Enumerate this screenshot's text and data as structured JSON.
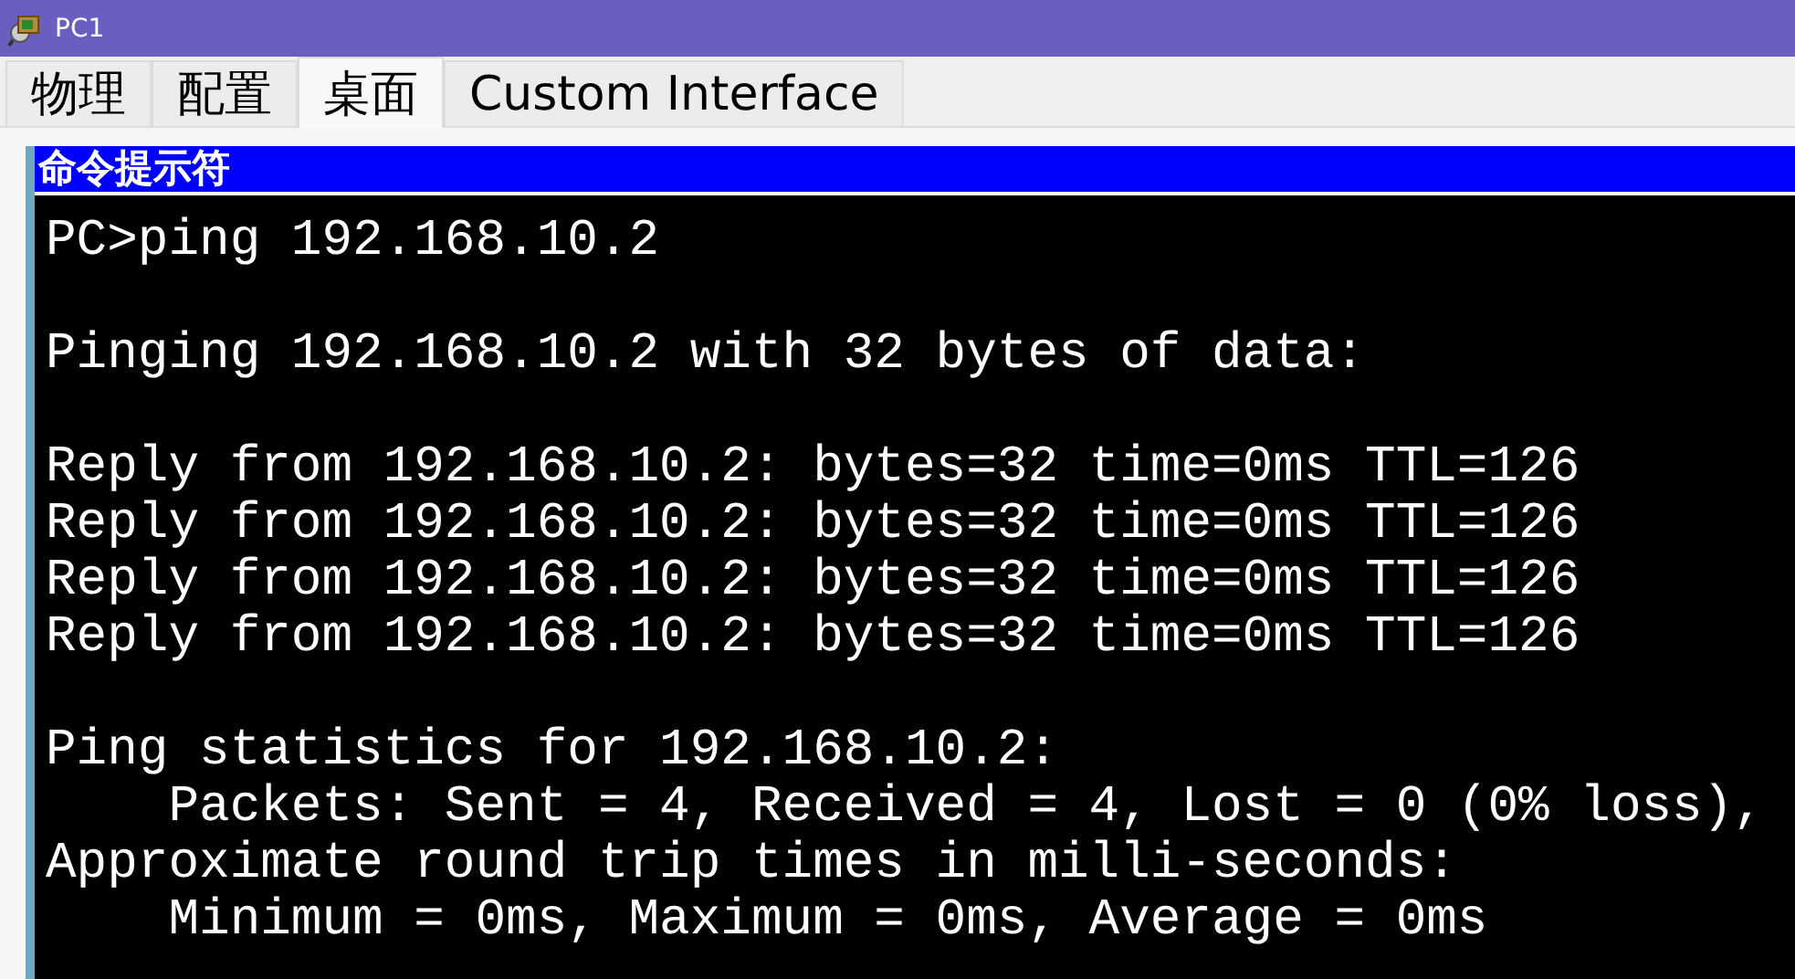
{
  "window": {
    "title": "PC1"
  },
  "tabs": [
    {
      "label": "物理",
      "selected": false
    },
    {
      "label": "配置",
      "selected": false
    },
    {
      "label": "桌面",
      "selected": true
    },
    {
      "label": "Custom Interface",
      "selected": false
    }
  ],
  "command_prompt": {
    "title": "命令提示符",
    "blocks": [
      [
        "PC>ping 192.168.10.2"
      ],
      [
        "Pinging 192.168.10.2 with 32 bytes of data:"
      ],
      [
        "Reply from 192.168.10.2: bytes=32 time=0ms TTL=126",
        "Reply from 192.168.10.2: bytes=32 time=0ms TTL=126",
        "Reply from 192.168.10.2: bytes=32 time=0ms TTL=126",
        "Reply from 192.168.10.2: bytes=32 time=0ms TTL=126"
      ],
      [
        "Ping statistics for 192.168.10.2:",
        "    Packets: Sent = 4, Received = 4, Lost = 0 (0% loss),",
        "Approximate round trip times in milli-seconds:",
        "    Minimum = 0ms, Maximum = 0ms, Average = 0ms"
      ]
    ]
  }
}
